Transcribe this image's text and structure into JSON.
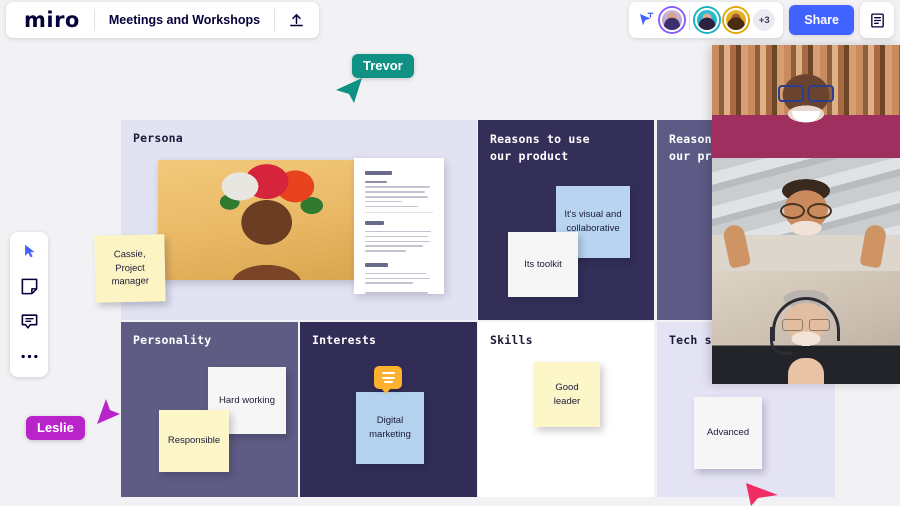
{
  "app": {
    "name": "miro",
    "board_title": "Meetings and Workshops"
  },
  "toolbar_top": {
    "upload_icon": "upload-icon",
    "cursor_share_icon": "cursor-share-icon",
    "share_label": "Share",
    "notes_icon": "notes-panel-icon",
    "extra_participants": "+3",
    "avatars": [
      {
        "name": "participant-avatar-1",
        "ring_color": "#8b5cf6"
      },
      {
        "name": "participant-avatar-2",
        "ring_color": "#18b2c4"
      },
      {
        "name": "participant-avatar-3",
        "ring_color": "#e0a800"
      }
    ],
    "accent_color": "#4262ff"
  },
  "toolbar_left": {
    "tools": [
      {
        "name": "select-cursor-tool",
        "icon": "cursor-arrow-icon",
        "selected": true
      },
      {
        "name": "sticky-note-tool",
        "icon": "sticky-note-icon",
        "selected": false
      },
      {
        "name": "comment-tool",
        "icon": "comment-icon",
        "selected": false
      },
      {
        "name": "more-tools",
        "icon": "ellipsis-icon",
        "selected": false
      }
    ]
  },
  "frames": [
    {
      "id": "persona",
      "title": "Persona",
      "bg": "#e2e2f3",
      "title_color": "dark"
    },
    {
      "id": "reasons1",
      "title": "Reasons to use\nour product",
      "bg": "#332f58",
      "title_color": "light"
    },
    {
      "id": "reasons2",
      "title": "Reasons\nour prod",
      "bg": "#5d5a85",
      "title_color": "light"
    },
    {
      "id": "personality",
      "title": "Personality",
      "bg": "#5f5c84",
      "title_color": "light"
    },
    {
      "id": "interests",
      "title": "Interests",
      "bg": "#312d57",
      "title_color": "light"
    },
    {
      "id": "skills",
      "title": "Skills",
      "bg": "#ffffff",
      "title_color": "dark"
    },
    {
      "id": "tech",
      "title": "Tech sav",
      "bg": "#e4e3f4",
      "title_color": "dark"
    }
  ],
  "stickies": {
    "cassie": "Cassie,\nProject\nmanager",
    "visual_collab": "It's visual and\ncollaborative",
    "toolkit": "Its toolkit",
    "hard_working": "Hard working",
    "responsible": "Responsible",
    "digital_marketing": "Digital\nmarketing",
    "good_leader": "Good\nleader",
    "advanced": "Advanced"
  },
  "media": {
    "persona_photo": "woman-with-flower-crown-photo",
    "persona_document": "persona-text-document"
  },
  "collaborators": [
    {
      "name": "Trevor",
      "color": "#0f9184",
      "cursor": "cursor-pointer-down-left"
    },
    {
      "name": "Leslie",
      "color": "#b824c9",
      "cursor": "cursor-pointer-up-right"
    },
    {
      "name": "",
      "color": "#ef2c63",
      "cursor": "cursor-pointer-right"
    }
  ],
  "video_call": {
    "tiles": [
      {
        "name": "video-tile-participant-1"
      },
      {
        "name": "video-tile-participant-2"
      },
      {
        "name": "video-tile-participant-3"
      }
    ]
  }
}
